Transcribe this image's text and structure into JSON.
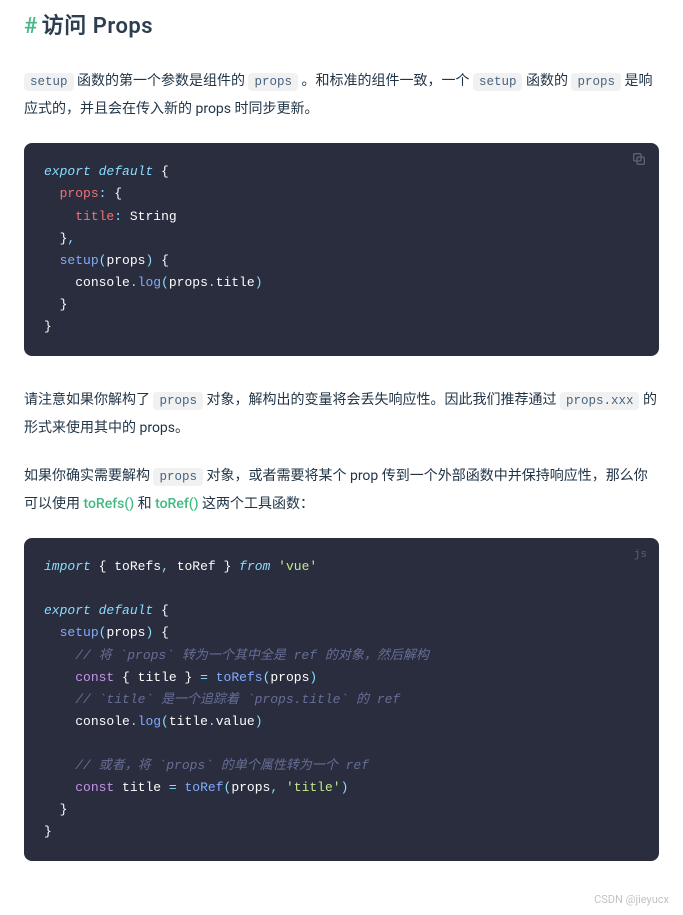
{
  "heading": {
    "hash": "#",
    "title": "访问 Props"
  },
  "p1": {
    "seg1": "函数的第一个参数是组件的",
    "seg2": "。和标准的组件一致，一个",
    "seg3": "函数的",
    "seg4": "是响应式的，并且会在传入新的 props 时同步更新。",
    "code_setup": "setup",
    "code_props": "props"
  },
  "code1": {
    "lang": "js",
    "l1_export": "export",
    "l1_default": "default",
    "l2_props": "props",
    "l3_title": "title",
    "l3_string": "String",
    "l5_setup": "setup",
    "l5_param": "props",
    "l6_console": "console",
    "l6_log": "log",
    "l6_props": "props",
    "l6_title": "title"
  },
  "p2": {
    "seg1": "请注意如果你解构了",
    "seg2": "对象，解构出的变量将会丢失响应性。因此我们推荐通过",
    "seg3": "的形式来使用其中的 props。",
    "code_props": "props",
    "code_propsxxx": "props.xxx"
  },
  "p3": {
    "seg1": "如果你确实需要解构",
    "seg2": "对象，或者需要将某个 prop 传到一个外部函数中并保持响应性，那么你可以使用",
    "seg3": "和",
    "seg4": "这两个工具函数：",
    "code_props": "props",
    "link_toRefs": "toRefs()",
    "link_toRef": "toRef()"
  },
  "code2": {
    "lang": "js",
    "l1_import": "import",
    "l1_toRefs": "toRefs",
    "l1_toRef": "toRef",
    "l1_from": "from",
    "l1_vue": "'vue'",
    "l3_export": "export",
    "l3_default": "default",
    "l4_setup": "setup",
    "l4_param": "props",
    "l5_comment": "// 将 `props` 转为一个其中全是 ref 的对象，然后解构",
    "l6_const": "const",
    "l6_title": "title",
    "l6_toRefs": "toRefs",
    "l6_props": "props",
    "l7_comment": "// `title` 是一个追踪着 `props.title` 的 ref",
    "l8_console": "console",
    "l8_log": "log",
    "l8_title": "title",
    "l8_value": "value",
    "l10_comment": "// 或者，将 `props` 的单个属性转为一个 ref",
    "l11_const": "const",
    "l11_title": "title",
    "l11_toRef": "toRef",
    "l11_props": "props",
    "l11_str": "'title'"
  },
  "watermark": "CSDN @jieyucx"
}
